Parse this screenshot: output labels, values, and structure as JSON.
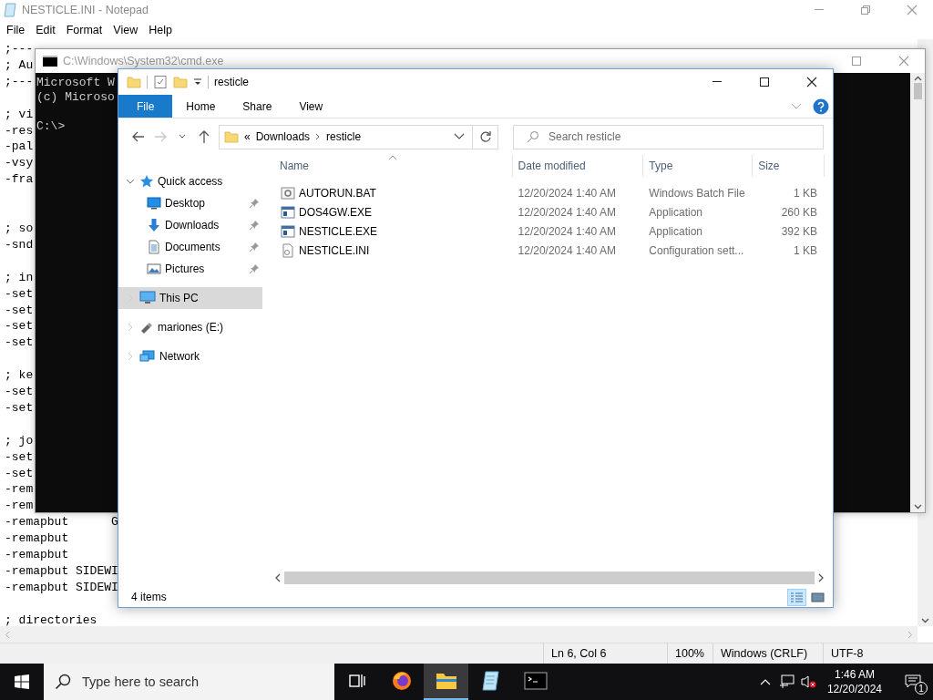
{
  "notepad": {
    "title": "NESTICLE.INI - Notepad",
    "menu": [
      "File",
      "Edit",
      "Format",
      "View",
      "Help"
    ],
    "text": ";---\n; Au\n;---\n\n; vi\n-res\n-pal\n-vsy\n-fra\n\n\n; so\n-snd\n\n; in\n-set\n-set\n-set\n-set\n\n; ke\n-set\n-set\n\n; jo\n-set\n-set\n-rem\n-rem\n-remapbut      G\n-remapbut\n-remapbut\n-remapbut SIDEWI\n-remapbut SIDEWI\n\n; directories",
    "status_bar": [
      "Ln 6, Col 6",
      "100%",
      "Windows (CRLF)",
      "UTF-8"
    ]
  },
  "cmd": {
    "title": "C:\\Windows\\System32\\cmd.exe",
    "output": "Microsoft W\n(c) Microso\n\nC:\\>"
  },
  "explorer": {
    "title": "resticle",
    "ribbon_tabs": [
      {
        "label": "File",
        "selected": true
      },
      {
        "label": "Home",
        "selected": false
      },
      {
        "label": "Share",
        "selected": false
      },
      {
        "label": "View",
        "selected": false
      }
    ],
    "nav_buttons": [
      {
        "kind": "back",
        "disabled": false
      },
      {
        "kind": "forward",
        "disabled": true
      }
    ],
    "address": {
      "overflow": "«",
      "path": [
        "Downloads",
        "resticle"
      ]
    },
    "search": {
      "placeholder": "Search resticle"
    },
    "navigation": [
      {
        "kind": "quick-access",
        "label": "Quick access",
        "expanded": true,
        "selected": false,
        "children": [
          {
            "kind": "desktop",
            "label": "Desktop",
            "pinned": true,
            "selected": false
          },
          {
            "kind": "downloads",
            "label": "Downloads",
            "pinned": true,
            "selected": false
          },
          {
            "kind": "documents",
            "label": "Documents",
            "pinned": true,
            "selected": false
          },
          {
            "kind": "pictures",
            "label": "Pictures",
            "pinned": true,
            "selected": false
          }
        ]
      },
      {
        "kind": "pc",
        "label": "This PC",
        "expanded": false,
        "selected": true
      },
      {
        "kind": "usb",
        "label": "mariones (E:)",
        "expanded": false,
        "selected": false
      },
      {
        "kind": "network",
        "label": "Network",
        "expanded": false,
        "selected": false
      }
    ],
    "columns": [
      {
        "label": "Name",
        "sorted": true
      },
      {
        "label": "Date modified",
        "sorted": false
      },
      {
        "label": "Type",
        "sorted": false
      },
      {
        "label": "Size",
        "sorted": false
      }
    ],
    "files": [
      {
        "kind": "batch",
        "name": "AUTORUN.BAT",
        "date": "12/20/2024 1:40 AM",
        "type": "Windows Batch File",
        "size": "1 KB"
      },
      {
        "kind": "exe",
        "name": "DOS4GW.EXE",
        "date": "12/20/2024 1:40 AM",
        "type": "Application",
        "size": "260 KB"
      },
      {
        "kind": "exe",
        "name": "NESTICLE.EXE",
        "date": "12/20/2024 1:40 AM",
        "type": "Application",
        "size": "392 KB"
      },
      {
        "kind": "ini",
        "name": "NESTICLE.INI",
        "date": "12/20/2024 1:40 AM",
        "type": "Configuration sett...",
        "size": "1 KB"
      }
    ],
    "status": "4 items",
    "views": [
      {
        "kind": "details",
        "selected": true
      },
      {
        "kind": "large-icons",
        "selected": false
      }
    ]
  },
  "taskbar": {
    "search": {
      "placeholder": "Type here to search"
    },
    "apps": [
      {
        "kind": "task-view",
        "selected": false
      },
      {
        "kind": "firefox",
        "selected": false
      },
      {
        "kind": "file-explorer",
        "selected": true
      },
      {
        "kind": "notepad",
        "selected": false
      },
      {
        "kind": "terminal",
        "selected": false
      }
    ],
    "time": "1:46 AM",
    "date": "12/20/2024",
    "notification_count": "1"
  }
}
